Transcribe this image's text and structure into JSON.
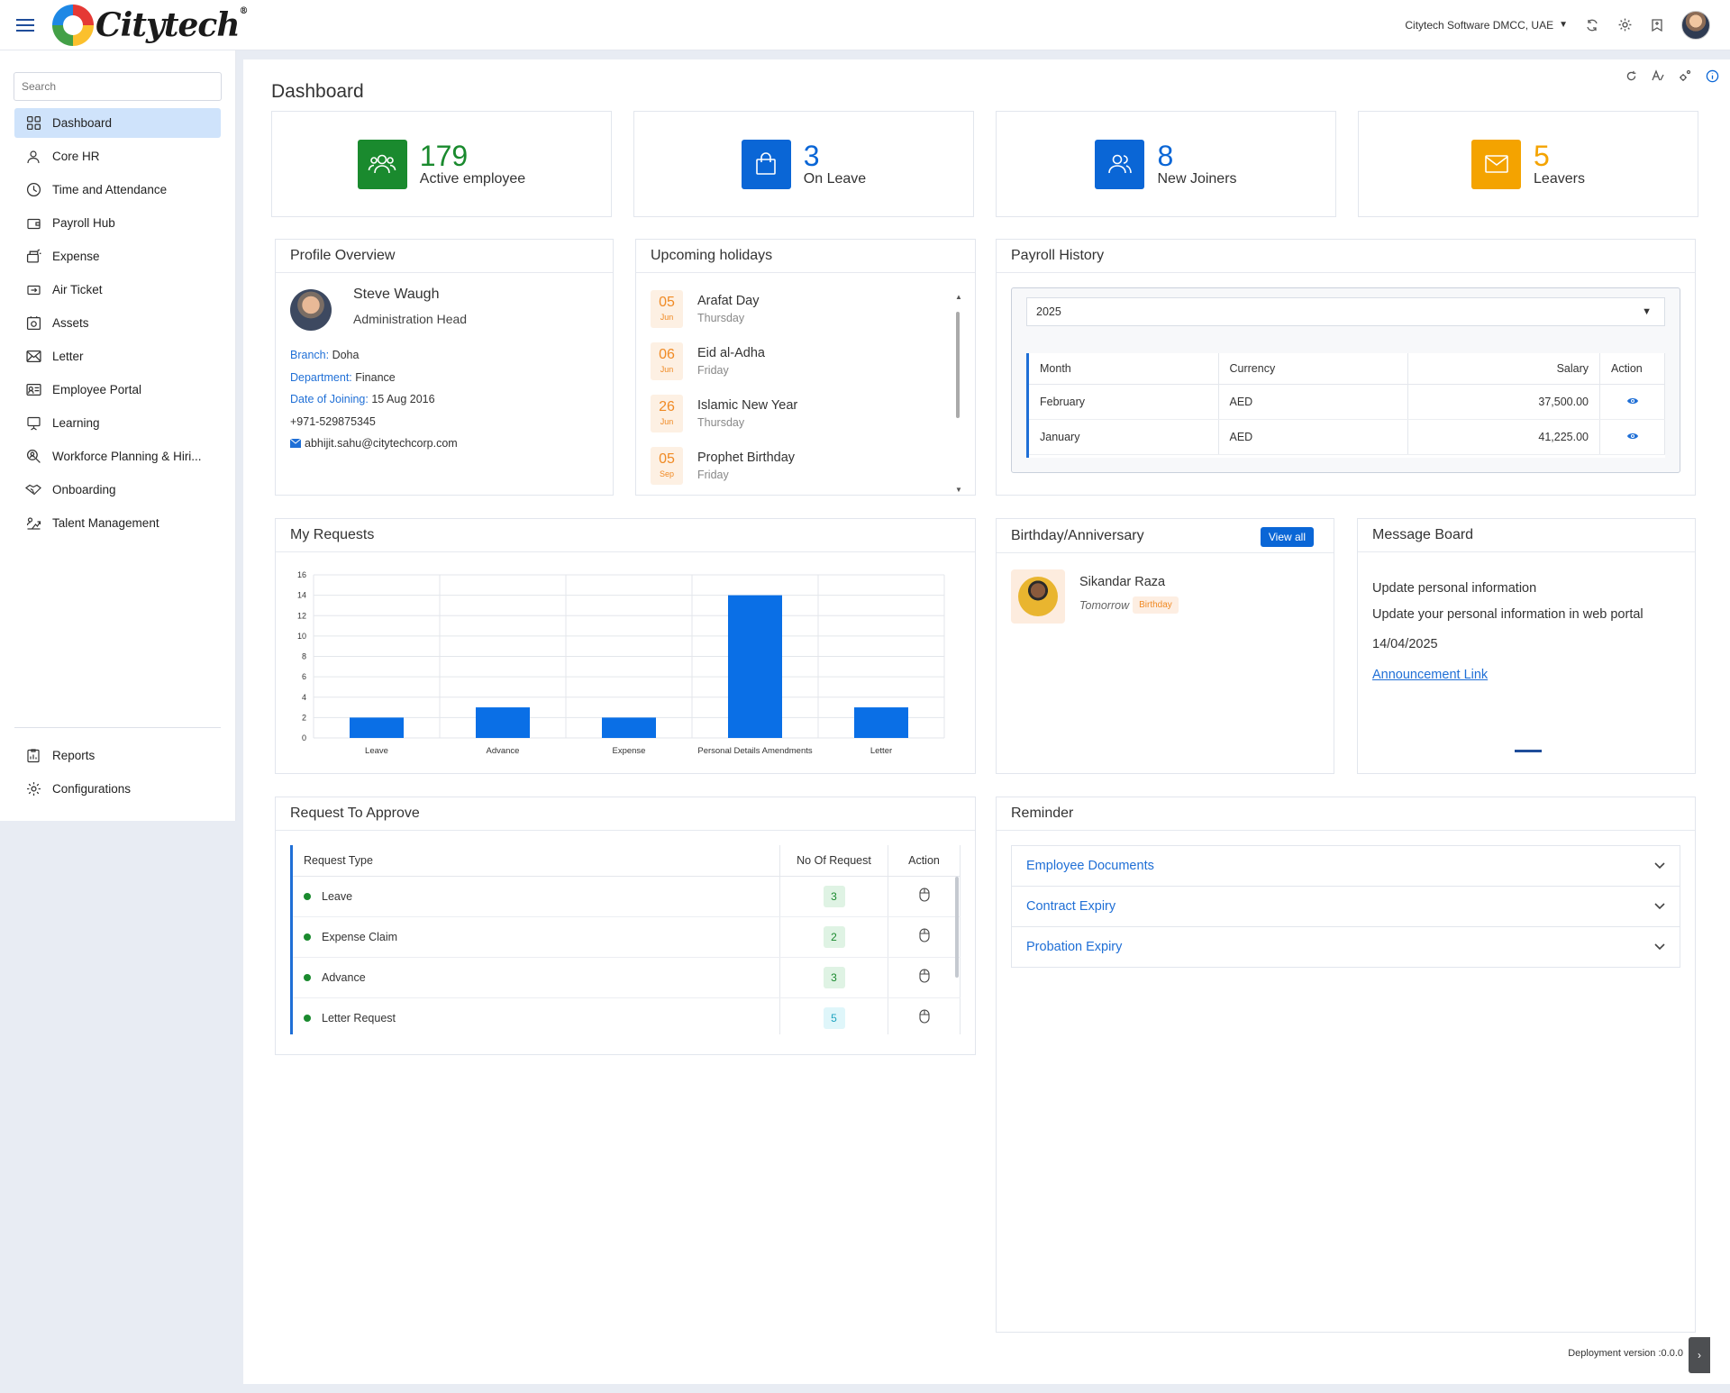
{
  "header": {
    "logo_text": "Citytech",
    "logo_mark": "®",
    "company": "Citytech Software DMCC, UAE"
  },
  "sidebar": {
    "search_placeholder": "Search",
    "items": [
      {
        "label": "Dashboard",
        "icon": "dashboard-icon"
      },
      {
        "label": "Core HR",
        "icon": "user-icon"
      },
      {
        "label": "Time and Attendance",
        "icon": "clock-icon"
      },
      {
        "label": "Payroll Hub",
        "icon": "wallet-icon"
      },
      {
        "label": "Expense",
        "icon": "expense-icon"
      },
      {
        "label": "Air Ticket",
        "icon": "ticket-icon"
      },
      {
        "label": "Assets",
        "icon": "assets-icon"
      },
      {
        "label": "Letter",
        "icon": "envelope-icon"
      },
      {
        "label": "Employee Portal",
        "icon": "id-card-icon"
      },
      {
        "label": "Learning",
        "icon": "presentation-icon"
      },
      {
        "label": "Workforce Planning & Hiri...",
        "icon": "search-user-icon"
      },
      {
        "label": "Onboarding",
        "icon": "handshake-icon"
      },
      {
        "label": "Talent Management",
        "icon": "growth-icon"
      }
    ],
    "bottom_items": [
      {
        "label": "Reports",
        "icon": "report-icon"
      },
      {
        "label": "Configurations",
        "icon": "gear-icon"
      }
    ]
  },
  "page": {
    "title": "Dashboard"
  },
  "kpis": [
    {
      "value": "179",
      "label": "Active employee",
      "color": "#1a8a2e",
      "icon": "group-icon"
    },
    {
      "value": "3",
      "label": "On Leave",
      "color": "#0a66d6",
      "icon": "bag-icon"
    },
    {
      "value": "8",
      "label": "New Joiners",
      "color": "#0a66d6",
      "icon": "users-icon"
    },
    {
      "value": "5",
      "label": "Leavers",
      "color": "#f4a300",
      "icon": "mail-icon"
    }
  ],
  "profile": {
    "title": "Profile Overview",
    "name": "Steve Waugh",
    "role": "Administration Head",
    "branch_label": "Branch:",
    "branch": "Doha",
    "dept_label": "Department:",
    "dept": "Finance",
    "doj_label": "Date of Joining:",
    "doj": "15 Aug 2016",
    "phone": "+971-529875345",
    "email": "abhijit.sahu@citytechcorp.com"
  },
  "holidays": {
    "title": "Upcoming holidays",
    "items": [
      {
        "day": "05",
        "month": "Jun",
        "name": "Arafat Day",
        "weekday": "Thursday"
      },
      {
        "day": "06",
        "month": "Jun",
        "name": "Eid al-Adha",
        "weekday": "Friday"
      },
      {
        "day": "26",
        "month": "Jun",
        "name": "Islamic New Year",
        "weekday": "Thursday"
      },
      {
        "day": "05",
        "month": "Sep",
        "name": "Prophet Birthday",
        "weekday": "Friday"
      }
    ]
  },
  "payroll": {
    "title": "Payroll History",
    "year": "2025",
    "headers": [
      "Month",
      "Currency",
      "Salary",
      "Action"
    ],
    "rows": [
      {
        "month": "February",
        "currency": "AED",
        "salary": "37,500.00"
      },
      {
        "month": "January",
        "currency": "AED",
        "salary": "41,225.00"
      }
    ]
  },
  "requests": {
    "title": "My Requests",
    "chart_data": {
      "type": "bar",
      "categories": [
        "Leave",
        "Advance",
        "Expense",
        "Personal Details Amendments",
        "Letter"
      ],
      "values": [
        2,
        3,
        2,
        14,
        3
      ],
      "ylim": [
        0,
        16
      ],
      "yticks": [
        0,
        2,
        4,
        6,
        8,
        10,
        12,
        14,
        16
      ],
      "grid": true,
      "color": "#0a6fe6"
    }
  },
  "birthday": {
    "title": "Birthday/Anniversary",
    "view_all": "View all",
    "name": "Sikandar Raza",
    "when": "Tomorrow",
    "type": "Birthday"
  },
  "message_board": {
    "title": "Message Board",
    "heading": "Update personal information",
    "body": "Update your personal information in web portal",
    "date": "14/04/2025",
    "link": "Announcement Link"
  },
  "approve": {
    "title": "Request To Approve",
    "headers": [
      "Request Type",
      "No Of Request",
      "Action"
    ],
    "rows": [
      {
        "type": "Leave",
        "count": "3",
        "style": "g"
      },
      {
        "type": "Expense Claim",
        "count": "2",
        "style": "g"
      },
      {
        "type": "Advance",
        "count": "3",
        "style": "g"
      },
      {
        "type": "Letter Request",
        "count": "5",
        "style": "c"
      }
    ]
  },
  "reminder": {
    "title": "Reminder",
    "items": [
      "Employee Documents",
      "Contract Expiry",
      "Probation Expiry"
    ]
  },
  "footer": {
    "deploy": "Deployment version :0.0.0"
  }
}
